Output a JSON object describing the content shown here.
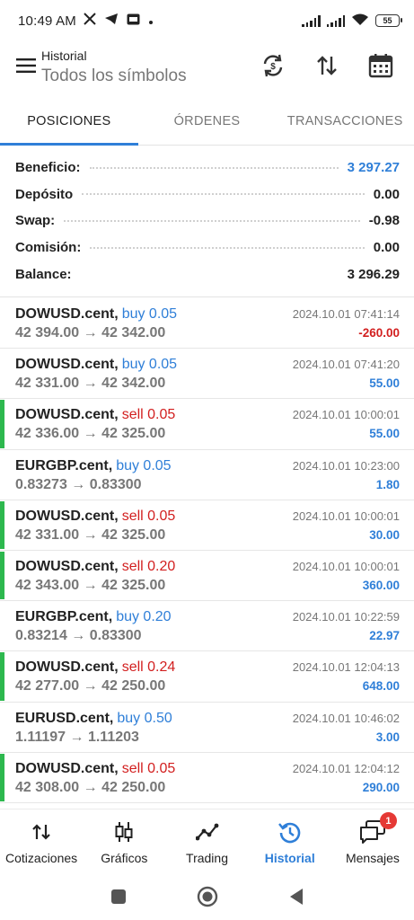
{
  "status_bar": {
    "time": "10:49 AM",
    "battery": "55",
    "icons": [
      "x-icon",
      "telegram-icon",
      "sim-icon",
      "dot-icon",
      "signal-icon",
      "signal-icon",
      "wifi-icon",
      "battery-icon"
    ]
  },
  "header": {
    "title": "Historial",
    "subtitle": "Todos los símbolos",
    "icons": [
      "menu-icon",
      "sync-icon",
      "sort-icon",
      "calendar-icon"
    ]
  },
  "tabs": [
    {
      "label": "POSICIONES",
      "active": true
    },
    {
      "label": "ÓRDENES",
      "active": false
    },
    {
      "label": "TRANSACCIONES",
      "active": false
    }
  ],
  "summary": [
    {
      "label": "Beneficio:",
      "value": "3 297.27"
    },
    {
      "label": "Depósito",
      "value": "0.00"
    },
    {
      "label": "Swap:",
      "value": "-0.98"
    },
    {
      "label": "Comisión:",
      "value": "0.00"
    },
    {
      "label": "Balance:",
      "value": "3 296.29"
    }
  ],
  "trades": [
    {
      "symbol": "DOWUSD.cent",
      "side": "buy 0.05",
      "time": "2024.10.01 07:41:14",
      "prices": "42 394.00 → 42 342.00",
      "profit": "-260.00",
      "marked": false
    },
    {
      "symbol": "DOWUSD.cent",
      "side": "buy 0.05",
      "time": "2024.10.01 07:41:20",
      "prices": "42 331.00 → 42 342.00",
      "profit": "55.00",
      "marked": false
    },
    {
      "symbol": "DOWUSD.cent",
      "side": "sell 0.05",
      "time": "2024.10.01 10:00:01",
      "prices": "42 336.00 → 42 325.00",
      "profit": "55.00",
      "marked": true
    },
    {
      "symbol": "EURGBP.cent",
      "side": "buy 0.05",
      "time": "2024.10.01 10:23:00",
      "prices": "0.83273 → 0.83300",
      "profit": "1.80",
      "marked": false
    },
    {
      "symbol": "DOWUSD.cent",
      "side": "sell 0.05",
      "time": "2024.10.01 10:00:01",
      "prices": "42 331.00 → 42 325.00",
      "profit": "30.00",
      "marked": true
    },
    {
      "symbol": "DOWUSD.cent",
      "side": "sell 0.20",
      "time": "2024.10.01 10:00:01",
      "prices": "42 343.00 → 42 325.00",
      "profit": "360.00",
      "marked": true
    },
    {
      "symbol": "EURGBP.cent",
      "side": "buy 0.20",
      "time": "2024.10.01 10:22:59",
      "prices": "0.83214 → 0.83300",
      "profit": "22.97",
      "marked": false
    },
    {
      "symbol": "DOWUSD.cent",
      "side": "sell 0.24",
      "time": "2024.10.01 12:04:13",
      "prices": "42 277.00 → 42 250.00",
      "profit": "648.00",
      "marked": true
    },
    {
      "symbol": "EURUSD.cent",
      "side": "buy 0.50",
      "time": "2024.10.01 10:46:02",
      "prices": "1.11197 → 1.11203",
      "profit": "3.00",
      "marked": false
    },
    {
      "symbol": "DOWUSD.cent",
      "side": "sell 0.05",
      "time": "2024.10.01 12:04:12",
      "prices": "42 308.00 → 42 250.00",
      "profit": "290.00",
      "marked": true
    }
  ],
  "bottom_nav": [
    {
      "label": "Cotizaciones",
      "icon": "quotes-icon"
    },
    {
      "label": "Gráficos",
      "icon": "charts-icon"
    },
    {
      "label": "Trading",
      "icon": "trading-icon"
    },
    {
      "label": "Historial",
      "icon": "history-icon",
      "active": true
    },
    {
      "label": "Mensajes",
      "icon": "messages-icon",
      "badge": "1"
    }
  ],
  "system_nav": [
    "recents-button",
    "home-button",
    "back-button"
  ],
  "colors": {
    "accent": "#2f7fd8",
    "sell": "#d21f1f",
    "marker": "#2db84e",
    "badge": "#e53935"
  }
}
